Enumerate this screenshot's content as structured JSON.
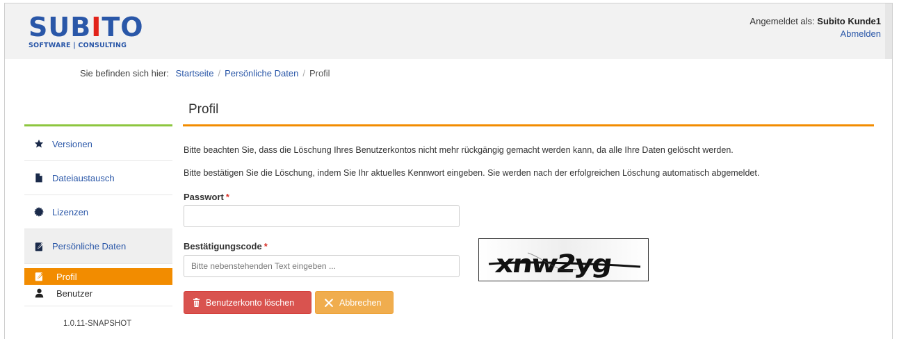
{
  "header": {
    "logo_main_left": "SUB",
    "logo_main_accent": "I",
    "logo_main_right": "TO",
    "logo_sub": "SOFTWARE | CONSULTING",
    "user_prefix": "Angemeldet als:",
    "user_name": "Subito Kunde1",
    "logout": "Abmelden"
  },
  "breadcrumb": {
    "prefix": "Sie befinden sich hier:",
    "items": [
      "Startseite",
      "Persönliche Daten"
    ],
    "current": "Profil"
  },
  "page": {
    "title": "Profil"
  },
  "sidebar": {
    "items": [
      {
        "label": "Versionen",
        "icon": "star-icon"
      },
      {
        "label": "Dateiaustausch",
        "icon": "file-icon"
      },
      {
        "label": "Lizenzen",
        "icon": "certificate-icon"
      },
      {
        "label": "Persönliche Daten",
        "icon": "edit-icon"
      }
    ],
    "subitems": [
      {
        "label": "Profil",
        "icon": "edit-icon",
        "active": true
      },
      {
        "label": "Benutzer",
        "icon": "user-icon",
        "active": false
      }
    ],
    "version": "1.0.11-SNAPSHOT"
  },
  "content": {
    "paragraph1": "Bitte beachten Sie, dass die Löschung Ihres Benutzerkontos nicht mehr rückgängig gemacht werden kann, da alle Ihre Daten gelöscht werden.",
    "paragraph2": "Bitte bestätigen Sie die Löschung, indem Sie Ihr aktuelles Kennwort eingeben. Sie werden nach der erfolgreichen Löschung automatisch abgemeldet.",
    "password_label": "Passwort",
    "password_value": "",
    "code_label": "Bestätigungscode",
    "code_placeholder": "Bitte nebenstehenden Text eingeben ...",
    "required_mark": "*",
    "captcha_text": "xnw2yg",
    "delete_button": "Benutzerkonto löschen",
    "cancel_button": "Abbrechen"
  },
  "colors": {
    "brand_blue": "#2a57a8",
    "accent_orange": "#f28c00",
    "sidebar_green": "#8dc63f",
    "danger": "#d9534f",
    "warning": "#f0ad4e"
  }
}
